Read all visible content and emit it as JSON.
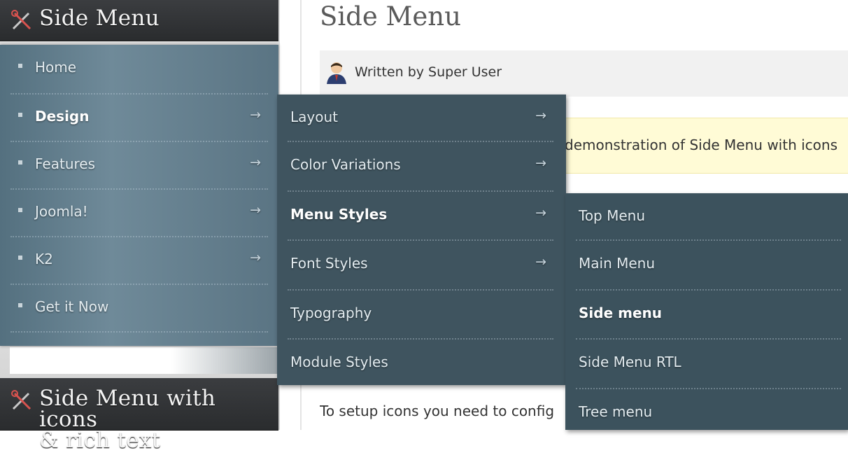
{
  "sidebar": {
    "module1_title": "Side Menu",
    "module2_title_line1": "Side Menu with icons",
    "module2_title_line2": "& rich text",
    "header_icon": "tools-icon"
  },
  "menu": {
    "level1": [
      {
        "label": "Home",
        "has_children": false,
        "active": false
      },
      {
        "label": "Design",
        "has_children": true,
        "active": true
      },
      {
        "label": "Features",
        "has_children": true,
        "active": false
      },
      {
        "label": "Joomla!",
        "has_children": true,
        "active": false
      },
      {
        "label": "K2",
        "has_children": true,
        "active": false
      },
      {
        "label": "Get it Now",
        "has_children": false,
        "active": false
      }
    ],
    "level2": [
      {
        "label": "Layout",
        "has_children": true,
        "active": false
      },
      {
        "label": "Color Variations",
        "has_children": true,
        "active": false
      },
      {
        "label": "Menu Styles",
        "has_children": true,
        "active": true
      },
      {
        "label": "Font Styles",
        "has_children": true,
        "active": false
      },
      {
        "label": "Typography",
        "has_children": false,
        "active": false
      },
      {
        "label": "Module Styles",
        "has_children": false,
        "active": false
      }
    ],
    "level3": [
      {
        "label": "Top Menu",
        "active": false
      },
      {
        "label": "Main Menu",
        "active": false
      },
      {
        "label": "Side menu",
        "active": true
      },
      {
        "label": "Side Menu RTL",
        "active": false
      },
      {
        "label": "Tree menu",
        "active": false
      }
    ],
    "arrow_glyph": "→"
  },
  "content": {
    "title": "Side Menu",
    "author": "Written by Super User",
    "author_icon": "user-avatar-icon",
    "note": "demonstration of Side Menu with icons",
    "setup_text": "To setup icons you need to config"
  }
}
